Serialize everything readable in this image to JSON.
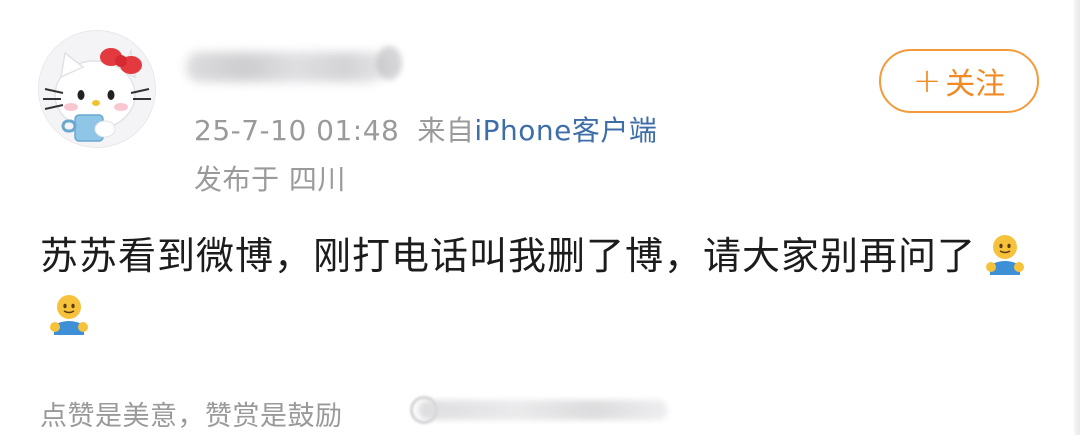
{
  "post": {
    "timestamp": "25-7-10 01:48",
    "source_prefix": "来自",
    "source": "iPhone客户端",
    "location": "发布于 四川",
    "text_main": "苏苏看到微博，刚打电话叫我删了博，请大家别再问了",
    "emojis": [
      "hug-emoji",
      "hug-emoji"
    ]
  },
  "actions": {
    "follow_label": "关注",
    "follow_plus": "+"
  },
  "footer": {
    "text": "点赞是美意，赞赏是鼓励"
  },
  "colors": {
    "accent": "#f28a23",
    "link": "#3d6ea8",
    "meta": "#9a9a9a",
    "text": "#1c1c1c"
  }
}
